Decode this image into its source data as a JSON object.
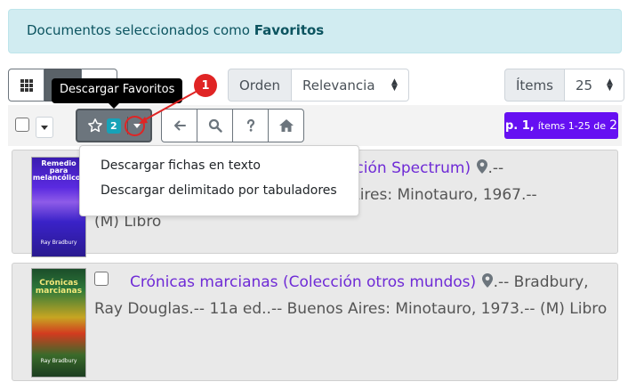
{
  "alert": {
    "prefix": "Documentos seleccionados como ",
    "bold": "Favoritos"
  },
  "view_buttons": [
    {
      "name": "grid-view",
      "active": false
    },
    {
      "name": "list-view",
      "active": true
    },
    {
      "name": "table-view",
      "active": false
    }
  ],
  "tooltip": "Descargar Favoritos",
  "sort": {
    "label": "Orden",
    "value": "Relevancia"
  },
  "items": {
    "label": "Ítems",
    "value": "25"
  },
  "favorites": {
    "count": "2"
  },
  "pager": {
    "page": "p. 1,",
    "range": "ítems 1-25 de",
    "total": "2"
  },
  "callout": "1",
  "dropdown": [
    "Descargar fichas en texto",
    "Descargar delimitado por tabuladores"
  ],
  "records": [
    {
      "title": "Remedio para melancólicos (Colección Spectrum)",
      "line1_rest": ".--",
      "line2": "Bradbury, Ray Douglas.-- Buenos Aires: Minotauro, 1967.--",
      "line3": "(M) Libro",
      "cover_title": "Remedio para melancólicos",
      "cover_author": "Ray Bradbury"
    },
    {
      "title": "Crónicas marcianas (Colección otros mundos)",
      "line1_rest": ".-- Bradbury,",
      "line2": "Ray Douglas.-- 11a ed..-- Buenos Aires: Minotauro, 1973.-- (M) Libro",
      "cover_title": "Crónicas marcianas",
      "cover_author": "Ray Bradbury"
    }
  ],
  "colors": {
    "accent": "#6610f2",
    "badge": "#17a2b8",
    "callout": "#e02424",
    "link": "#6f2bd6"
  }
}
